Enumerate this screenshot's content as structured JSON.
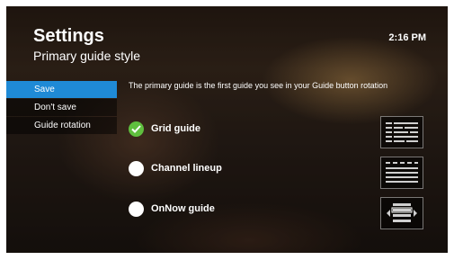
{
  "header": {
    "title": "Settings",
    "subtitle": "Primary guide style",
    "clock": "2:16 PM"
  },
  "menu": {
    "items": [
      {
        "label": "Save",
        "selected": true
      },
      {
        "label": "Don't save",
        "selected": false
      },
      {
        "label": "Guide rotation",
        "selected": false
      }
    ]
  },
  "description": "The primary guide is the first guide you see in your Guide button rotation",
  "options": [
    {
      "label": "Grid guide",
      "checked": true,
      "icon": "grid-guide-thumbnail-icon"
    },
    {
      "label": "Channel lineup",
      "checked": false,
      "icon": "channel-lineup-thumbnail-icon"
    },
    {
      "label": "OnNow guide",
      "checked": false,
      "icon": "onnow-guide-thumbnail-icon"
    }
  ],
  "colors": {
    "accent": "#1f8ad6",
    "check": "#5fbf3e"
  }
}
